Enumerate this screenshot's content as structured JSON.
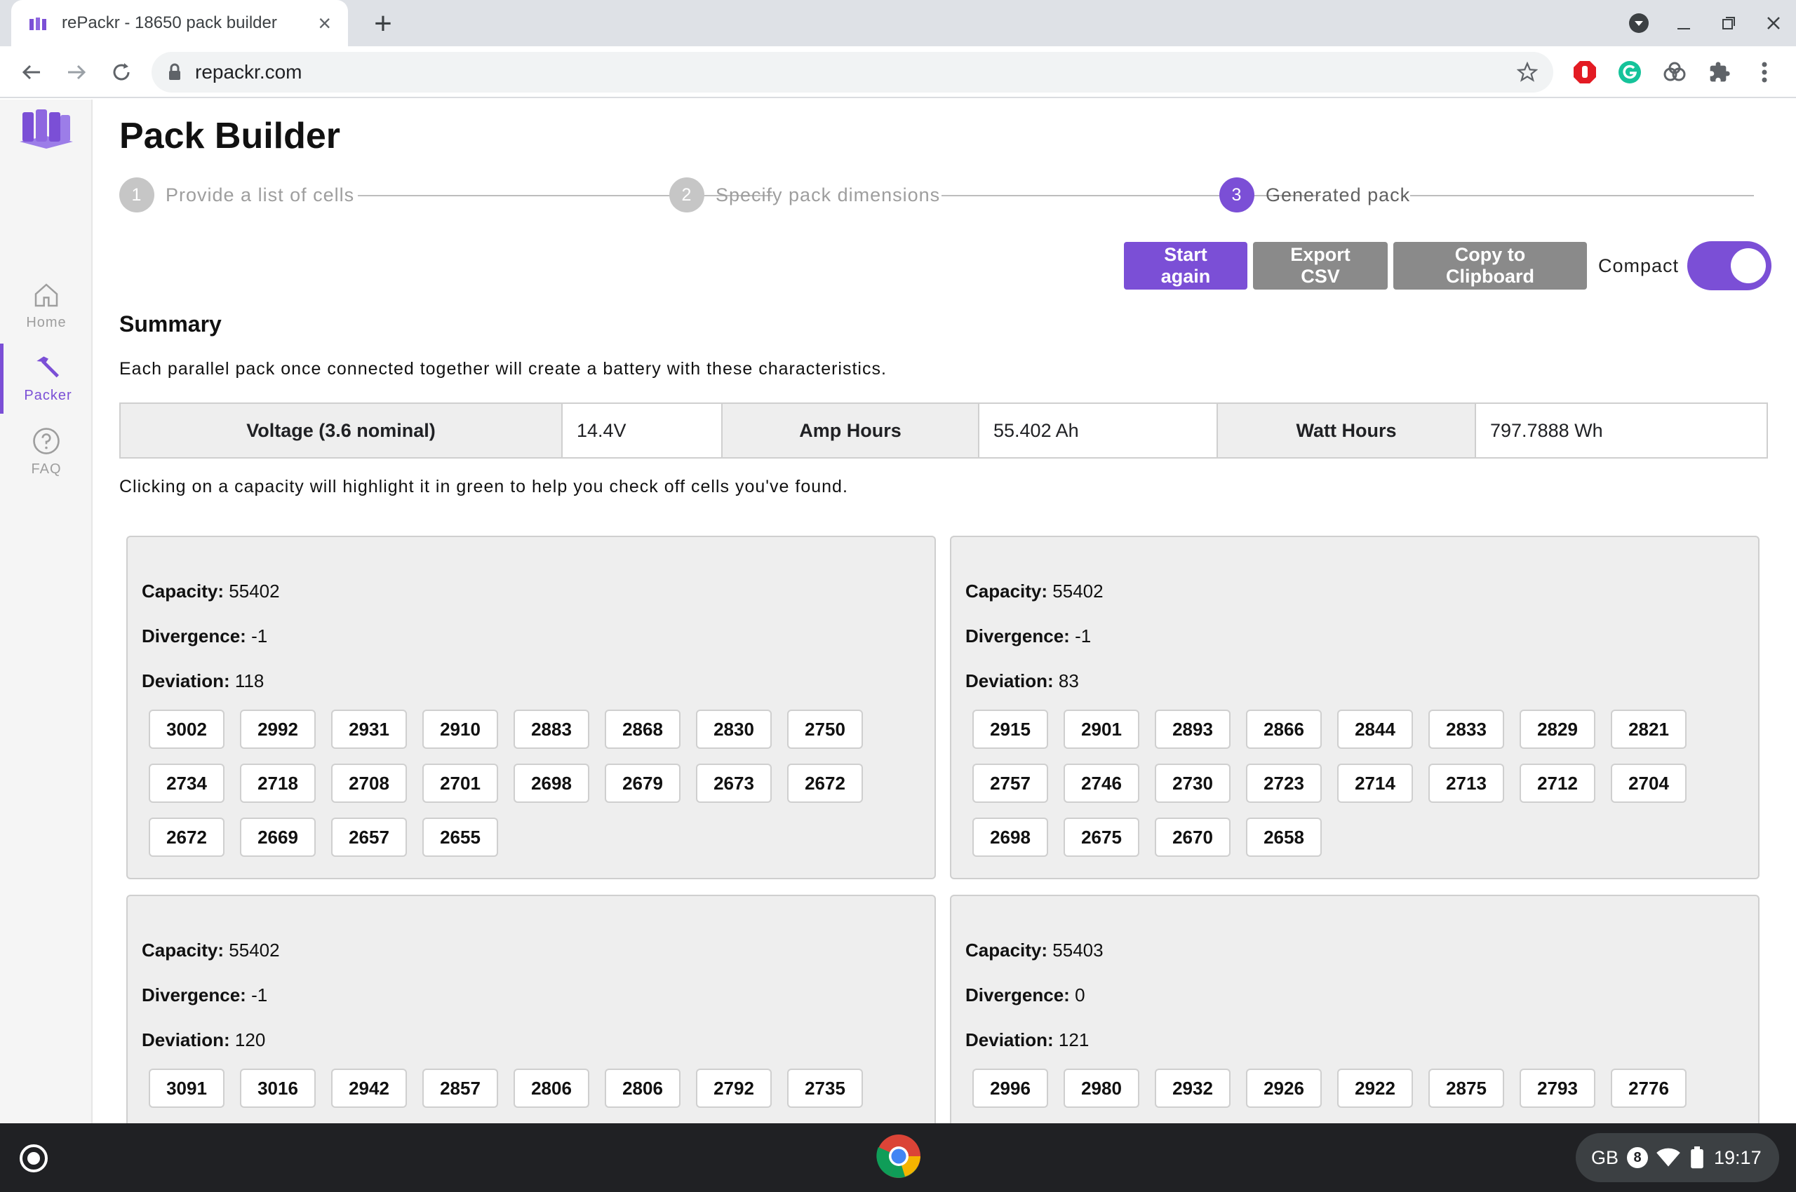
{
  "browser": {
    "tab_title": "rePackr - 18650 pack builder",
    "url": "repackr.com"
  },
  "sidebar": {
    "items": [
      {
        "label": "Home",
        "icon": "home-icon",
        "active": false
      },
      {
        "label": "Packer",
        "icon": "hammer-icon",
        "active": true
      },
      {
        "label": "FAQ",
        "icon": "help-circle-icon",
        "active": false
      }
    ]
  },
  "page": {
    "title": "Pack Builder",
    "steps": [
      {
        "num": "1",
        "label": "Provide a list of cells"
      },
      {
        "num": "2",
        "label": "Specify pack dimensions"
      },
      {
        "num": "3",
        "label": "Generated pack"
      }
    ],
    "actions": {
      "start_again": "Start again",
      "export_csv": "Export CSV",
      "copy_clipboard": "Copy to Clipboard",
      "compact_label": "Compact",
      "compact_on": true
    },
    "summary": {
      "title": "Summary",
      "description": "Each parallel pack once connected together will create a battery with these characteristics.",
      "voltage_label": "Voltage (3.6 nominal)",
      "voltage_value": "14.4V",
      "amp_hours_label": "Amp Hours",
      "amp_hours_value": "55.402 Ah",
      "watt_hours_label": "Watt Hours",
      "watt_hours_value": "797.7888 Wh"
    },
    "hint": "Clicking on a capacity will highlight it in green to help you check off cells you've found."
  },
  "packs": [
    {
      "capacity": "55402",
      "divergence": "-1",
      "deviation": "118",
      "cells": [
        "3002",
        "2992",
        "2931",
        "2910",
        "2883",
        "2868",
        "2830",
        "2750",
        "2734",
        "2718",
        "2708",
        "2701",
        "2698",
        "2679",
        "2673",
        "2672",
        "2672",
        "2669",
        "2657",
        "2655"
      ]
    },
    {
      "capacity": "55402",
      "divergence": "-1",
      "deviation": "83",
      "cells": [
        "2915",
        "2901",
        "2893",
        "2866",
        "2844",
        "2833",
        "2829",
        "2821",
        "2757",
        "2746",
        "2730",
        "2723",
        "2714",
        "2713",
        "2712",
        "2704",
        "2698",
        "2675",
        "2670",
        "2658"
      ]
    },
    {
      "capacity": "55402",
      "divergence": "-1",
      "deviation": "120",
      "cells": [
        "3091",
        "3016",
        "2942",
        "2857",
        "2806",
        "2806",
        "2792",
        "2735"
      ]
    },
    {
      "capacity": "55403",
      "divergence": "0",
      "deviation": "121",
      "cells": [
        "2996",
        "2980",
        "2932",
        "2926",
        "2922",
        "2875",
        "2793",
        "2776"
      ]
    }
  ],
  "labels": {
    "capacity": "Capacity:",
    "divergence": "Divergence:",
    "deviation": "Deviation:"
  },
  "system": {
    "locale": "GB",
    "notifications": "8",
    "time": "19:17"
  },
  "colors": {
    "accent": "#7b4fd6",
    "grey_button": "#8a8a8a"
  }
}
